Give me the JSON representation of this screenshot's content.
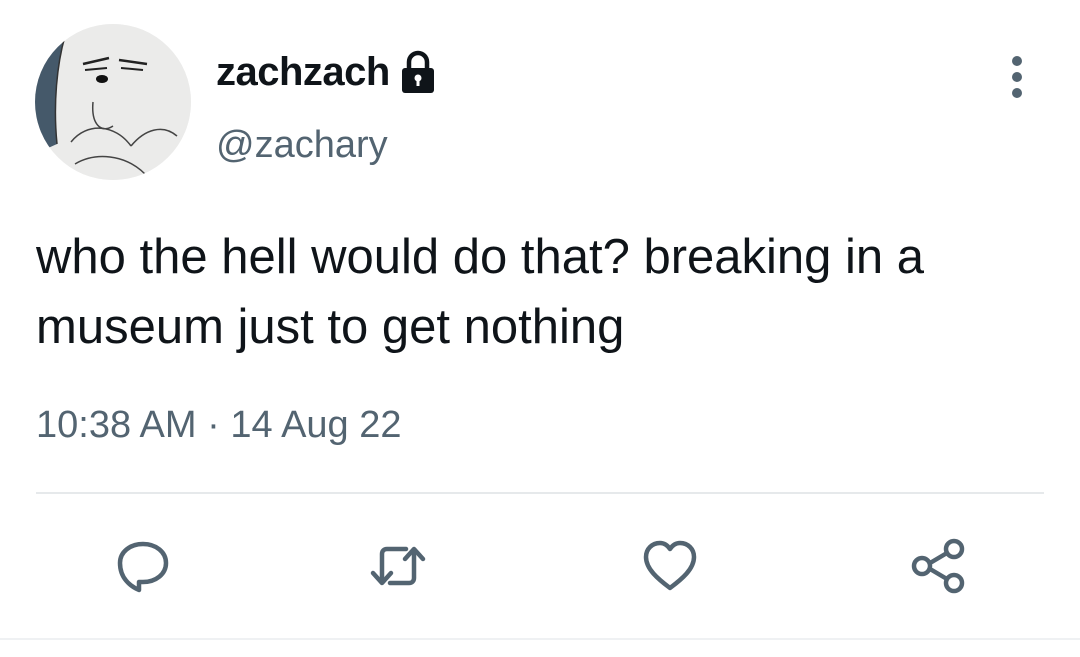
{
  "tweet": {
    "display_name": "zachzach",
    "handle": "@zachary",
    "text": "who the hell would do that? breaking in a museum just to get nothing",
    "time": "10:38 AM",
    "separator": "·",
    "date": "14 Aug 22",
    "protected": true
  },
  "icons": {
    "avatar": "cartoon-bear-avatar",
    "lock": "lock-icon",
    "more": "more-vertical-icon",
    "reply": "reply-icon",
    "retweet": "retweet-icon",
    "like": "heart-icon",
    "share": "share-icon"
  },
  "colors": {
    "text": "#0f1419",
    "secondary": "#536471",
    "icon": "#536471",
    "divider": "#e6e9eb"
  }
}
